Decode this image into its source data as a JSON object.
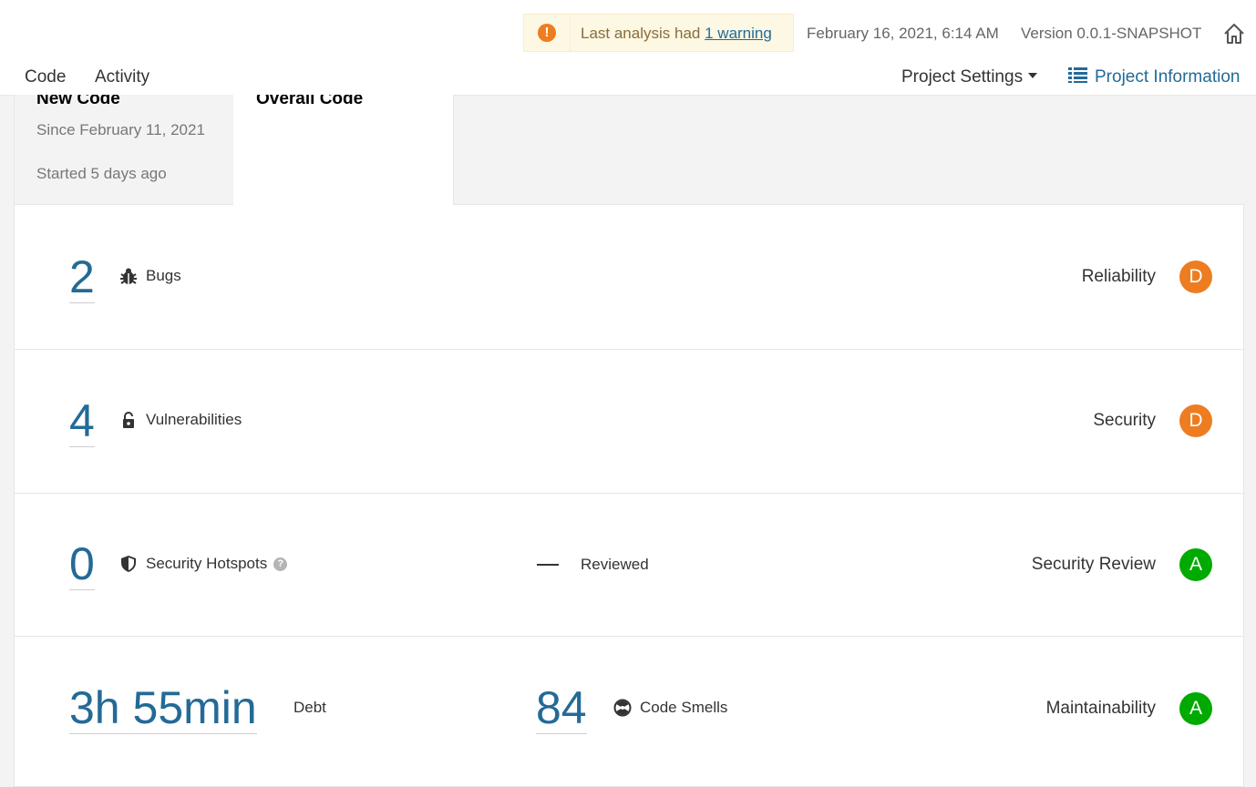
{
  "header": {
    "warning": {
      "icon": "exclamation-circle-icon",
      "text_prefix": "Last analysis had",
      "link_label": "1 warning"
    },
    "analysis_date": "February 16, 2021, 6:14 AM",
    "version": "Version 0.0.1-SNAPSHOT",
    "home_icon": "home-icon",
    "nav": {
      "code": "Code",
      "activity": "Activity"
    },
    "project_settings": "Project Settings",
    "project_information": "Project Information"
  },
  "tabs": {
    "new_code": {
      "title": "New Code",
      "since": "Since February 11, 2021",
      "started": "Started 5 days ago"
    },
    "overall_code": {
      "title": "Overall Code"
    }
  },
  "metrics": {
    "bugs": {
      "value": "2",
      "label": "Bugs",
      "icon": "bug-icon",
      "domain": "Reliability",
      "rating": "D",
      "rating_color": "#ed7d20"
    },
    "vulnerabilities": {
      "value": "4",
      "label": "Vulnerabilities",
      "icon": "unlocked-icon",
      "domain": "Security",
      "rating": "D",
      "rating_color": "#ed7d20"
    },
    "hotspots": {
      "value": "0",
      "label": "Security Hotspots",
      "icon": "shield-icon",
      "reviewed_value": "—",
      "reviewed_label": "Reviewed",
      "domain": "Security Review",
      "rating": "A",
      "rating_color": "#00aa00"
    },
    "maintainability": {
      "debt_value": "3h 55min",
      "debt_label": "Debt",
      "smells_value": "84",
      "smells_label": "Code Smells",
      "icon": "code-smell-icon",
      "domain": "Maintainability",
      "rating": "A",
      "rating_color": "#00aa00"
    }
  }
}
